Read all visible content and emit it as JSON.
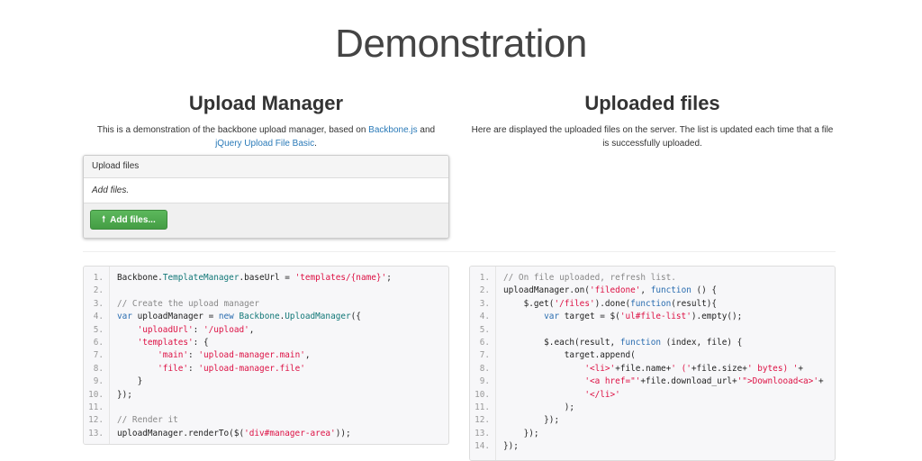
{
  "page": {
    "title": "Demonstration"
  },
  "left": {
    "title": "Upload Manager",
    "desc_prefix": "This is a demonstration of the backbone upload manager, based on ",
    "link1": "Backbone.js",
    "desc_mid": " and",
    "link2": "jQuery Upload File Basic",
    "desc_suffix": ".",
    "panel": {
      "heading": "Upload files",
      "body": "Add files.",
      "button": "Add files...",
      "button_color": "#5cb85c"
    }
  },
  "right": {
    "title": "Uploaded files",
    "desc": "Here are displayed the uploaded files on the server. The list is updated each time that a file is successfully uploaded."
  },
  "code_left": [
    [
      [
        "Backbone.",
        "n"
      ],
      [
        "TemplateManager",
        "cls"
      ],
      [
        ".baseUrl = ",
        "n"
      ],
      [
        "'templates/{name}'",
        "str"
      ],
      [
        ";",
        "n"
      ]
    ],
    [],
    [
      [
        "// Create the upload manager",
        "cm"
      ]
    ],
    [
      [
        "var ",
        "kw"
      ],
      [
        "uploadManager = ",
        "n"
      ],
      [
        "new ",
        "kw"
      ],
      [
        "Backbone",
        "cls"
      ],
      [
        ".",
        "n"
      ],
      [
        "UploadManager",
        "cls"
      ],
      [
        "({",
        "n"
      ]
    ],
    [
      [
        "    ",
        "n"
      ],
      [
        "'uploadUrl'",
        "str"
      ],
      [
        ": ",
        "n"
      ],
      [
        "'/upload'",
        "str"
      ],
      [
        ",",
        "n"
      ]
    ],
    [
      [
        "    ",
        "n"
      ],
      [
        "'templates'",
        "str"
      ],
      [
        ": {",
        "n"
      ]
    ],
    [
      [
        "        ",
        "n"
      ],
      [
        "'main'",
        "str"
      ],
      [
        ": ",
        "n"
      ],
      [
        "'upload-manager.main'",
        "str"
      ],
      [
        ",",
        "n"
      ]
    ],
    [
      [
        "        ",
        "n"
      ],
      [
        "'file'",
        "str"
      ],
      [
        ": ",
        "n"
      ],
      [
        "'upload-manager.file'",
        "str"
      ]
    ],
    [
      [
        "    }",
        "n"
      ]
    ],
    [
      [
        "});",
        "n"
      ]
    ],
    [],
    [
      [
        "// Render it",
        "cm"
      ]
    ],
    [
      [
        "uploadManager.renderTo($(",
        "n"
      ],
      [
        "'div#manager-area'",
        "str"
      ],
      [
        "));",
        "n"
      ]
    ]
  ],
  "code_right": [
    [
      [
        "// On file uploaded, refresh list.",
        "cm"
      ]
    ],
    [
      [
        "uploadManager.on(",
        "n"
      ],
      [
        "'filedone'",
        "str"
      ],
      [
        ", ",
        "n"
      ],
      [
        "function",
        "kw"
      ],
      [
        " () {",
        "n"
      ]
    ],
    [
      [
        "    $.get(",
        "n"
      ],
      [
        "'/files'",
        "str"
      ],
      [
        ").done(",
        "n"
      ],
      [
        "function",
        "kw"
      ],
      [
        "(result){",
        "n"
      ]
    ],
    [
      [
        "        ",
        "n"
      ],
      [
        "var ",
        "kw"
      ],
      [
        "target = $(",
        "n"
      ],
      [
        "'ul#file-list'",
        "str"
      ],
      [
        ").empty();",
        "n"
      ]
    ],
    [],
    [
      [
        "        $.each(result, ",
        "n"
      ],
      [
        "function",
        "kw"
      ],
      [
        " (index, file) {",
        "n"
      ]
    ],
    [
      [
        "            target.append(",
        "n"
      ]
    ],
    [
      [
        "                ",
        "n"
      ],
      [
        "'<li>'",
        "str"
      ],
      [
        "+file.name+",
        "n"
      ],
      [
        "' ('",
        "str"
      ],
      [
        "+file.size+",
        "n"
      ],
      [
        "' bytes) '",
        "str"
      ],
      [
        "+",
        "n"
      ]
    ],
    [
      [
        "                ",
        "n"
      ],
      [
        "'<a href=\"'",
        "str"
      ],
      [
        "+file.download_url+",
        "n"
      ],
      [
        "'\">Downlooad<a>'",
        "str"
      ],
      [
        "+",
        "n"
      ]
    ],
    [
      [
        "                ",
        "n"
      ],
      [
        "'</li>'",
        "str"
      ]
    ],
    [
      [
        "            );",
        "n"
      ]
    ],
    [
      [
        "        });",
        "n"
      ]
    ],
    [
      [
        "    });",
        "n"
      ]
    ],
    [
      [
        "});",
        "n"
      ]
    ]
  ]
}
